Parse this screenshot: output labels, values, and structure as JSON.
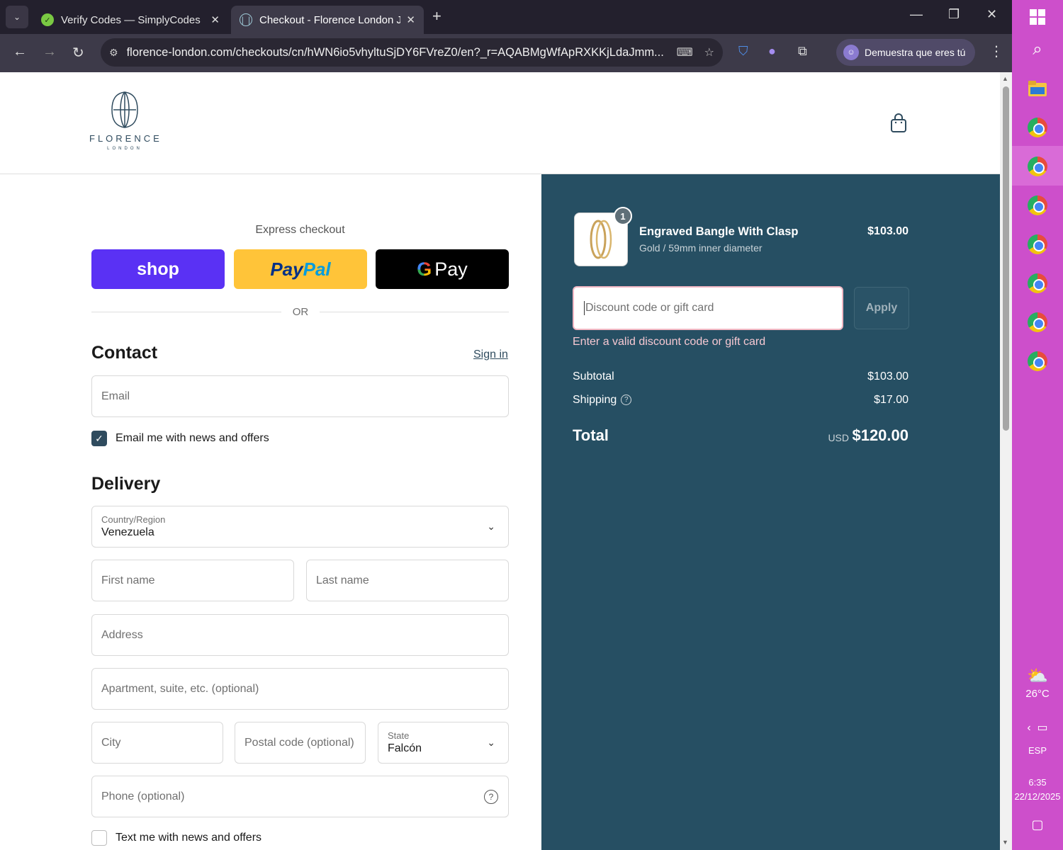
{
  "browser": {
    "tabs": [
      {
        "title": "Verify Codes — SimplyCodes",
        "active": false
      },
      {
        "title": "Checkout - Florence London Je",
        "active": true
      }
    ],
    "url": "florence-london.com/checkouts/cn/hWN6io5vhyltuSjDY6FVreZ0/en?_r=AQABMgWfApRXKKjLdaJmm...",
    "profile_label": "Demuestra que eres tú",
    "icons": [
      "back-icon",
      "forward-icon",
      "reload-icon",
      "site-info-icon",
      "translate-icon",
      "star-icon",
      "shield-extension-icon",
      "extension-icon",
      "puzzle-icon",
      "menu-icon"
    ]
  },
  "taskbar": {
    "weather": "26°C",
    "language": "ESP",
    "time": "6:35",
    "date": "22/12/2025"
  },
  "store": {
    "brand": "FLORENCE",
    "brand_sub": "LONDON"
  },
  "checkout": {
    "express_title": "Express checkout",
    "shop_label": "shop",
    "paypal_label_a": "Pay",
    "paypal_label_b": "Pal",
    "gpay_label": "Pay",
    "or_label": "OR",
    "contact_title": "Contact",
    "sign_in": "Sign in",
    "email_placeholder": "Email",
    "email_news": "Email me with news and offers",
    "email_news_checked": true,
    "delivery_title": "Delivery",
    "country_label": "Country/Region",
    "country_value": "Venezuela",
    "first_name": "First name",
    "last_name": "Last name",
    "address": "Address",
    "apartment": "Apartment, suite, etc. (optional)",
    "city": "City",
    "postal": "Postal code (optional)",
    "state_label": "State",
    "state_value": "Falcón",
    "phone": "Phone (optional)",
    "text_news": "Text me with news and offers",
    "text_news_checked": false
  },
  "summary": {
    "item": {
      "quantity": "1",
      "name": "Engraved Bangle With Clasp",
      "variant": "Gold / 59mm inner diameter",
      "price": "$103.00"
    },
    "discount_placeholder": "Discount code or gift card",
    "apply_label": "Apply",
    "discount_error": "Enter a valid discount code or gift card",
    "subtotal_label": "Subtotal",
    "subtotal_value": "$103.00",
    "shipping_label": "Shipping",
    "shipping_value": "$17.00",
    "total_label": "Total",
    "currency": "USD",
    "total_value": "$120.00",
    "colors": {
      "panel": "#264f63",
      "accent": "#2f4b5e",
      "shop": "#5a31f4",
      "paypal": "#ffc439"
    }
  }
}
